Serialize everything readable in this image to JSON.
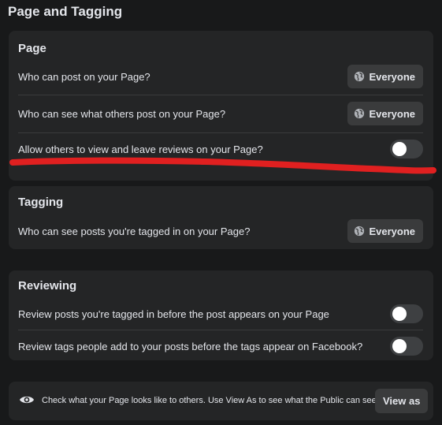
{
  "header": {
    "title": "Page and Tagging"
  },
  "page_section": {
    "title": "Page",
    "rows": [
      {
        "label": "Who can post on your Page?",
        "button": "Everyone"
      },
      {
        "label": "Who can see what others post on your Page?",
        "button": "Everyone"
      },
      {
        "label": "Allow others to view and leave reviews on your Page?",
        "toggle_on": false
      }
    ]
  },
  "tagging_section": {
    "title": "Tagging",
    "rows": [
      {
        "label": "Who can see posts you're tagged in on your Page?",
        "button": "Everyone"
      }
    ]
  },
  "reviewing_section": {
    "title": "Reviewing",
    "rows": [
      {
        "label": "Review posts you're tagged in before the post appears on your Page",
        "toggle_on": false
      },
      {
        "label": "Review tags people add to your posts before the tags appear on Facebook?",
        "toggle_on": false
      }
    ]
  },
  "view_as": {
    "text": "Check what your Page looks like to others. Use View As to see what the Public can see.",
    "button": "View as"
  },
  "icons": {
    "audience": "globe-icon",
    "view_as": "eye-icon"
  },
  "colors": {
    "background": "#18191a",
    "card": "#242526",
    "button": "#3a3b3c",
    "text": "#e4e6eb",
    "toggle_off": "#3e4042",
    "annotation_underline": "#e02020"
  }
}
